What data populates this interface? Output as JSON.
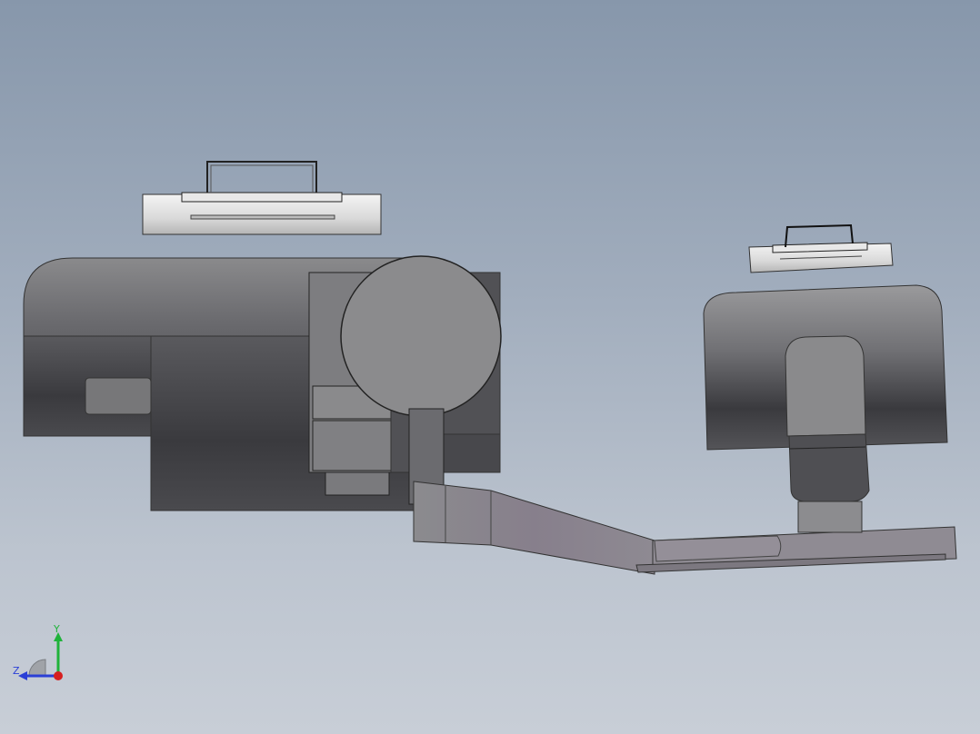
{
  "viewport": {
    "background_top": "#8797ab",
    "background_bottom": "#c8ced7"
  },
  "model": {
    "body_color": "#6f6f74",
    "dark_color": "#3c3c40",
    "light_color": "#909092",
    "arm_color": "#8a8390"
  },
  "triad": {
    "y_label": "Y",
    "z_label": "Z",
    "y_color": "#1fb33a",
    "z_color": "#2a3fd6",
    "x_color": "#d61f1f"
  }
}
